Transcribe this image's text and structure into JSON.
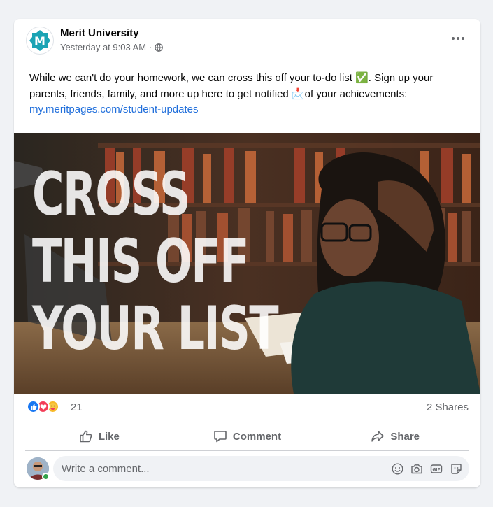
{
  "post": {
    "author": "Merit University",
    "timestamp": "Yesterday at 9:03 AM",
    "separator": "·",
    "text_part1": "While we can't do your homework, we can cross this off your to-do list ✅. Sign up your parents, friends, family, and more up here to get notified 📩of your achievements:",
    "link": "my.meritpages.com/student-updates",
    "image_headline": [
      "CROSS",
      "THIS OFF",
      "YOUR LIST"
    ]
  },
  "reactions": {
    "count": "21",
    "shares": "2 Shares",
    "types": [
      "like",
      "love",
      "care"
    ]
  },
  "actions": {
    "like": "Like",
    "comment": "Comment",
    "share": "Share"
  },
  "comment": {
    "placeholder": "Write a comment..."
  },
  "colors": {
    "brand_teal": "#1aa3b4",
    "link": "#216fdb",
    "like_blue": "#1877f2",
    "love_red": "#f33e58",
    "care_yellow": "#f7b928"
  }
}
